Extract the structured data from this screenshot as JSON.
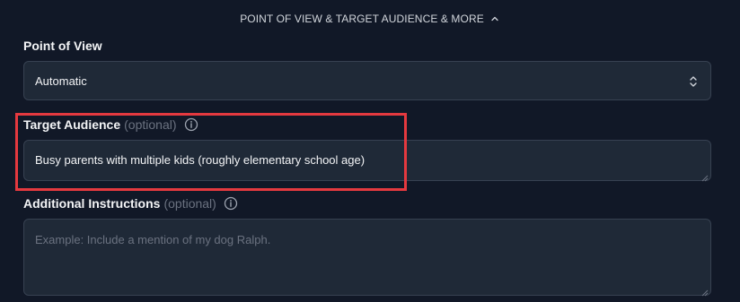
{
  "section": {
    "title": "POINT OF VIEW & TARGET AUDIENCE & MORE",
    "toggle_icon": "chevron-up-icon"
  },
  "point_of_view": {
    "label": "Point of View",
    "selected": "Automatic",
    "icon": "chevron-up-down-icon"
  },
  "target_audience": {
    "label": "Target Audience",
    "optional": "(optional)",
    "info_icon": "info-icon",
    "value": "Busy parents with multiple kids (roughly elementary school age)"
  },
  "additional_instructions": {
    "label": "Additional Instructions",
    "optional": "(optional)",
    "info_icon": "info-icon",
    "placeholder": "Example: Include a mention of my dog Ralph."
  },
  "colors": {
    "background": "#111827",
    "field_background": "#1f2937",
    "field_border": "#374151",
    "highlight": "#e5393f"
  }
}
